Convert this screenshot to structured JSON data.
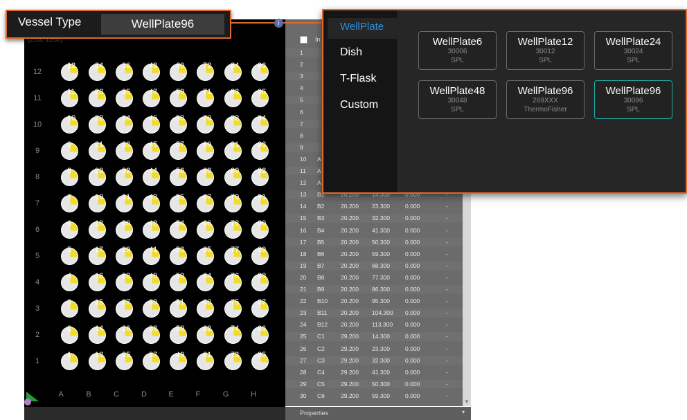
{
  "vessel_type": {
    "label": "Vessel Type",
    "value": "WellPlate96"
  },
  "plate": {
    "coord_readout": "(253, 1263)",
    "row_labels": [
      "12",
      "11",
      "10",
      "9",
      "8",
      "7",
      "6",
      "5",
      "4",
      "3",
      "2",
      "1"
    ],
    "col_labels": [
      "A",
      "B",
      "C",
      "D",
      "E",
      "F",
      "G",
      "H"
    ]
  },
  "table": {
    "header": "In",
    "rows": [
      [
        "1",
        "",
        "",
        "",
        "",
        ""
      ],
      [
        "2",
        "",
        "",
        "",
        "",
        ""
      ],
      [
        "3",
        "",
        "",
        "",
        "",
        ""
      ],
      [
        "4",
        "",
        "",
        "",
        "",
        ""
      ],
      [
        "5",
        "",
        "",
        "",
        "",
        ""
      ],
      [
        "6",
        "",
        "",
        "",
        "",
        ""
      ],
      [
        "7",
        "",
        "",
        "",
        "",
        ""
      ],
      [
        "8",
        "",
        "",
        "",
        "",
        ""
      ],
      [
        "9",
        "",
        "",
        "",
        "",
        ""
      ],
      [
        "10",
        "A",
        "",
        "",
        "",
        ""
      ],
      [
        "11",
        "A",
        "",
        "",
        "",
        ""
      ],
      [
        "12",
        "A",
        "",
        "",
        "",
        ""
      ],
      [
        "13",
        "B1",
        "20.200",
        "14.300",
        "0.000",
        "-"
      ],
      [
        "14",
        "B2",
        "20.200",
        "23.300",
        "0.000",
        "-"
      ],
      [
        "15",
        "B3",
        "20.200",
        "32.300",
        "0.000",
        "-"
      ],
      [
        "16",
        "B4",
        "20.200",
        "41.300",
        "0.000",
        "-"
      ],
      [
        "17",
        "B5",
        "20.200",
        "50.300",
        "0.000",
        "-"
      ],
      [
        "18",
        "B6",
        "20.200",
        "59.300",
        "0.000",
        "-"
      ],
      [
        "19",
        "B7",
        "20.200",
        "68.300",
        "0.000",
        "-"
      ],
      [
        "20",
        "B8",
        "20.200",
        "77.300",
        "0.000",
        "-"
      ],
      [
        "21",
        "B9",
        "20.200",
        "86.300",
        "0.000",
        "-"
      ],
      [
        "22",
        "B10",
        "20.200",
        "95.300",
        "0.000",
        "-"
      ],
      [
        "23",
        "B11",
        "20.200",
        "104.300",
        "0.000",
        "-"
      ],
      [
        "24",
        "B12",
        "20.200",
        "113.300",
        "0.000",
        "-"
      ],
      [
        "25",
        "C1",
        "29.200",
        "14.300",
        "0.000",
        "-"
      ],
      [
        "26",
        "C2",
        "29.200",
        "23.300",
        "0.000",
        "-"
      ],
      [
        "27",
        "C3",
        "29.200",
        "32.300",
        "0.000",
        "-"
      ],
      [
        "28",
        "C4",
        "29.200",
        "41.300",
        "0.000",
        "-"
      ],
      [
        "29",
        "C5",
        "29.200",
        "50.300",
        "0.000",
        "-"
      ],
      [
        "30",
        "C6",
        "29.200",
        "59.300",
        "0.000",
        "-"
      ]
    ]
  },
  "properties_label": "Properties",
  "popup": {
    "tabs": [
      "WellPlate",
      "Dish",
      "T-Flask",
      "Custom"
    ],
    "active_tab": "WellPlate",
    "cards": [
      {
        "name": "WellPlate6",
        "code": "30006",
        "maker": "SPL",
        "selected": false
      },
      {
        "name": "WellPlate12",
        "code": "30012",
        "maker": "SPL",
        "selected": false
      },
      {
        "name": "WellPlate24",
        "code": "30024",
        "maker": "SPL",
        "selected": false
      },
      {
        "name": "WellPlate48",
        "code": "30048",
        "maker": "SPL",
        "selected": false
      },
      {
        "name": "WellPlate96",
        "code": "269XXX",
        "maker": "ThermoFisher",
        "selected": false
      },
      {
        "name": "WellPlate96",
        "code": "30096",
        "maker": "SPL",
        "selected": true
      }
    ]
  },
  "colors": {
    "accent_orange": "#e06a2c",
    "tab_blue": "#2f8fd8",
    "selected_teal": "#1fb0a8",
    "well_marker": "#f2dc2a"
  }
}
